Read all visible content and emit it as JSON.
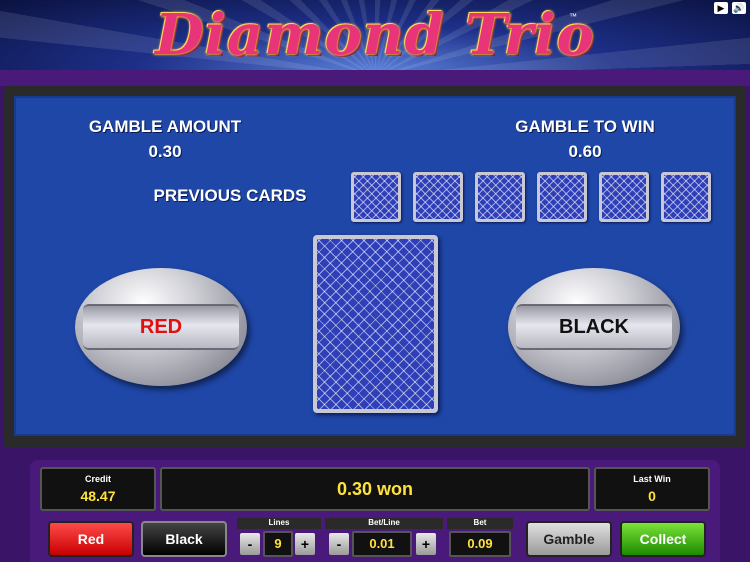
{
  "header": {
    "logo_text": "Diamond Trio",
    "trademark": "™",
    "top_buttons": [
      "▶",
      "🔊"
    ]
  },
  "gamble": {
    "amount_label": "GAMBLE AMOUNT",
    "amount_value": "0.30",
    "to_win_label": "GAMBLE TO WIN",
    "to_win_value": "0.60",
    "previous_cards_label": "PREVIOUS CARDS",
    "red_label": "RED",
    "black_label": "BLACK"
  },
  "panel": {
    "credit_label": "Credit",
    "credit_value": "48.47",
    "message": "0.30 won",
    "last_win_label": "Last Win",
    "last_win_value": "0",
    "lines_label": "Lines",
    "lines_value": "9",
    "bet_line_label": "Bet/Line",
    "bet_line_value": "0.01",
    "bet_label": "Bet",
    "bet_value": "0.09",
    "minus": "-",
    "plus": "+",
    "red_button": "Red",
    "black_button": "Black",
    "gamble_button": "Gamble",
    "collect_button": "Collect"
  },
  "colors": {
    "board_blue": "#1f47a8",
    "frame_purple": "#4a1a7a",
    "value_yellow": "#ffe23a",
    "red_text": "#e01010"
  }
}
